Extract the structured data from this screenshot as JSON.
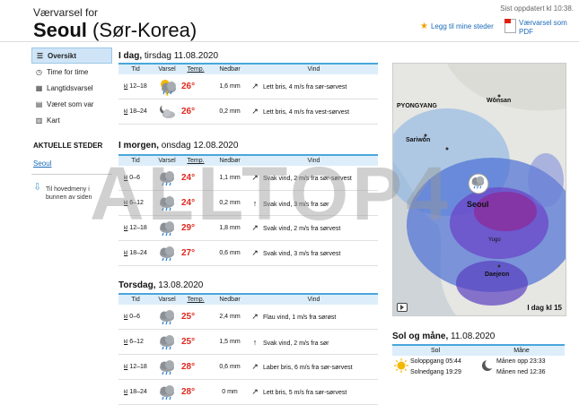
{
  "header": {
    "small_title": "Værvarsel for",
    "city": "Seoul",
    "country": "(Sør-Korea)",
    "updated": "Sist oppdatert kl 10:38.",
    "favorite_label": "Legg til mine steder",
    "pdf_label_1": "Værvarsel som",
    "pdf_label_2": "PDF"
  },
  "sidebar": {
    "items": [
      {
        "label": "Oversikt",
        "icon": "list-icon"
      },
      {
        "label": "Time for time",
        "icon": "clock-icon"
      },
      {
        "label": "Langtidsvarsel",
        "icon": "calendar-icon"
      },
      {
        "label": "Været som var",
        "icon": "history-icon"
      },
      {
        "label": "Kart",
        "icon": "map-icon"
      }
    ],
    "current_places_title": "AKTUELLE STEDER",
    "current_place": "Seoul",
    "back_to_top": "Til hovedmeny i bunnen av siden"
  },
  "columns": {
    "time": "Tid",
    "forecast": "Varsel",
    "temp": "Temp.",
    "rain": "Nedbør",
    "wind": "Vind"
  },
  "time_prefix": "kl",
  "days": [
    {
      "title_bold": "I dag,",
      "title_rest": "tirsdag 11.08.2020",
      "rows": [
        {
          "time": "12–18",
          "icon": "partly-cloudy-rain-thunder-icon",
          "temp": "26°",
          "rain": "1,6 mm",
          "arrow": "↗",
          "wind": "Lett bris, 4 m/s fra sør-sørvest"
        },
        {
          "time": "18–24",
          "icon": "moon-cloud-icon",
          "temp": "26°",
          "rain": "0,2 mm",
          "arrow": "↗",
          "wind": "Lett bris, 4 m/s fra vest-sørvest"
        }
      ]
    },
    {
      "title_bold": "I morgen,",
      "title_rest": "onsdag 12.08.2020",
      "rows": [
        {
          "time": "0–6",
          "icon": "cloud-rain-icon",
          "temp": "24°",
          "rain": "1,1 mm",
          "arrow": "↗",
          "wind": "Svak vind, 2 m/s fra sør-sørvest"
        },
        {
          "time": "6–12",
          "icon": "cloud-rain-icon",
          "temp": "24°",
          "rain": "0,2 mm",
          "arrow": "↑",
          "wind": "Svak vind, 3 m/s fra sør"
        },
        {
          "time": "12–18",
          "icon": "cloud-rain-icon",
          "temp": "29°",
          "rain": "1,8 mm",
          "arrow": "↗",
          "wind": "Svak vind, 2 m/s fra sørvest"
        },
        {
          "time": "18–24",
          "icon": "cloud-rain-icon",
          "temp": "27°",
          "rain": "0,6 mm",
          "arrow": "↗",
          "wind": "Svak vind, 3 m/s fra sørvest"
        }
      ]
    },
    {
      "title_bold": "Torsdag,",
      "title_rest": "13.08.2020",
      "rows": [
        {
          "time": "0–6",
          "icon": "cloud-rain-icon",
          "temp": "25°",
          "rain": "2,4 mm",
          "arrow": "↗",
          "wind": "Flau vind, 1 m/s fra sørøst"
        },
        {
          "time": "6–12",
          "icon": "cloud-rain-icon",
          "temp": "25°",
          "rain": "1,5 mm",
          "arrow": "↑",
          "wind": "Svak vind, 2 m/s fra sør"
        },
        {
          "time": "12–18",
          "icon": "cloud-rain-icon",
          "temp": "28°",
          "rain": "0,6 mm",
          "arrow": "↗",
          "wind": "Laber bris, 6 m/s fra sør-sørvest"
        },
        {
          "time": "18–24",
          "icon": "cloud-rain-icon",
          "temp": "28°",
          "rain": "0 mm",
          "arrow": "↗",
          "wind": "Lett bris, 5 m/s fra sør-sørvest"
        }
      ]
    }
  ],
  "map": {
    "labels": [
      "PYONGYANG",
      "Wŏnsan",
      "Sariwŏn",
      "Seoul",
      "Yugo",
      "Daejeon"
    ],
    "caption": "I dag kl 15"
  },
  "sun_moon": {
    "title_bold": "Sol og måne,",
    "title_rest": "11.08.2020",
    "sun_header": "Sol",
    "moon_header": "Måne",
    "sunrise": "Soloppgang 05:44",
    "sunset": "Solnedgang 19:29",
    "moonrise": "Månen opp 23:33",
    "moonset": "Månen ned 12:36"
  },
  "watermark": "ALLTOP4"
}
